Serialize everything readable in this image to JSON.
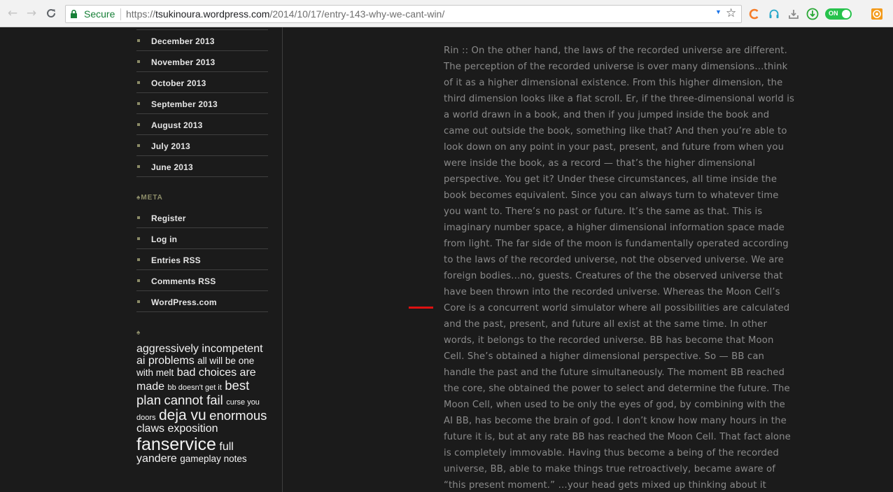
{
  "browser": {
    "secure_label": "Secure",
    "url_scheme": "https://",
    "url_host": "tsukinoura.wordpress.com",
    "url_path": "/2014/10/17/entry-143-why-we-cant-win/",
    "toggle_label": "ON",
    "colors": {
      "secure": "#188038",
      "toggle": "#27c24c"
    }
  },
  "sidebar": {
    "archives": [
      {
        "label": "December 2013"
      },
      {
        "label": "November 2013"
      },
      {
        "label": "October 2013"
      },
      {
        "label": "September 2013"
      },
      {
        "label": "August 2013"
      },
      {
        "label": "July 2013"
      },
      {
        "label": "June 2013"
      }
    ],
    "meta_heading": "♠META",
    "meta_items": [
      {
        "label": "Register"
      },
      {
        "label": "Log in"
      },
      {
        "label": "Entries RSS"
      },
      {
        "label": "Comments RSS"
      },
      {
        "label": "WordPress.com"
      }
    ],
    "tags_heading": "♠",
    "tags": [
      {
        "text": "aggressively incompetent ai",
        "size": "l"
      },
      {
        "text": "problems",
        "size": "l"
      },
      {
        "text": "all will be one with melt",
        "size": "m"
      },
      {
        "text": "bad choices are made",
        "size": "l"
      },
      {
        "text": "bb doesn't get it",
        "size": "s"
      },
      {
        "text": "best plan",
        "size": "xl"
      },
      {
        "text": "cannot fail",
        "size": "xl"
      },
      {
        "text": "curse you doors",
        "size": "s"
      },
      {
        "text": "deja vu",
        "size": "xxl"
      },
      {
        "text": "enormous",
        "size": "xl"
      },
      {
        "text": "claws",
        "size": "l"
      },
      {
        "text": "exposition",
        "size": "l"
      },
      {
        "text": "fanservice",
        "size": "xxxl"
      },
      {
        "text": "full yandere",
        "size": "l"
      },
      {
        "text": "gameplay notes",
        "size": "m"
      }
    ]
  },
  "article": {
    "text": "Rin :: On the other hand, the laws of the recorded universe are different. The perception of the recorded universe is over many dimensions…think of it as a higher dimensional existence. From this higher dimension, the third dimension looks like a flat scroll. Er, if the three-dimensional world is a world drawn in a book, and then if you jumped inside the book and came out outside the book, something like that? And then you’re able to look down on any point in your past, present, and future from when you were inside the book, as a record — that’s the higher dimensional perspective. You get it? Under these circumstances, all time inside the book becomes equivalent. Since you can always turn to whatever time you want to. There’s no past or future. It’s the same as that. This is imaginary number space, a higher dimensional information space made from light. The far side of the moon is fundamentally operated according to the laws of the recorded universe, not the observed universe. We are foreign bodies…no, guests. Creatures of the the observed universe that have been thrown into the recorded universe. Whereas the Moon Cell’s Core is a concurrent world simulator where all possibilities are calculated and the past, present, and future all exist at the same time. In other words, it belongs to the recorded universe. BB has become that Moon Cell. She’s obtained a higher dimensional perspective. So — BB can handle the past and the future simultaneously. The moment BB reached the core, she obtained the power to select and determine the future. The Moon Cell, when used to be only the eyes of god, by combining with the AI BB, has become the brain of god. I don’t know how many hours in the future it is, but at any rate BB has reached the Moon Cell. That fact alone is completely immovable. Having thus become a being of the recorded universe, BB, able to make things true retroactively, became aware of “this present moment.” …your head gets mixed up thinking about it"
  }
}
